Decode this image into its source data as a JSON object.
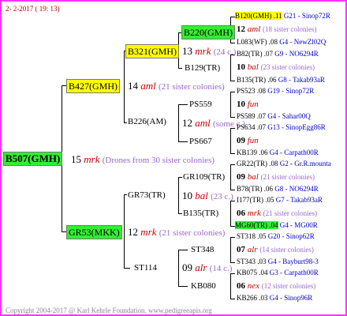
{
  "header_date": "2-  2-2017 ( 19: 13)",
  "footer": "Copyright 2004-2017 @ Karl Kehrle Foundation.   www.pedigreeapis.org",
  "colors": {
    "frame": "#ff33ff",
    "highlight_yellow": "#ffff00",
    "highlight_green": "#33ee33",
    "link_blue": "#0000cc",
    "note_purple": "#9966cc",
    "mating_red": "#cc0000"
  },
  "g0": {
    "name": "B507(GMH)",
    "num": "15",
    "mark": "mrk",
    "note": "(Drones from 30 sister colonies)"
  },
  "g1a": {
    "name": "B427(GMH)",
    "num": "14",
    "mark": "aml",
    "note": "(21 sister colonies)"
  },
  "g1b": {
    "name": "GR53(MKK)",
    "num": "12",
    "mark": "mrk",
    "note": "(21 sister colonies)"
  },
  "g2a": {
    "name": "B321(GMH)",
    "num": "13",
    "mark": "mrk",
    "note": "(24 c.)"
  },
  "g2b": {
    "name": "B226(AM)",
    "num": "12",
    "mark": "aml",
    "note": "(some c.)"
  },
  "g2c": {
    "name": "GR73(TR)",
    "num": "10",
    "mark": "bal",
    "note": "(23 c.)"
  },
  "g2d": {
    "name": "ST114",
    "num": "09",
    "mark": "alr",
    "note": "(14 c.)"
  },
  "g3": [
    {
      "name": "B220(GMH)"
    },
    {
      "name": "B129(TR)"
    },
    {
      "name": "PS559"
    },
    {
      "name": "PS667"
    },
    {
      "name": "GR109(TR)"
    },
    {
      "name": "B135(TR)"
    },
    {
      "name": "ST348"
    },
    {
      "name": "KB080"
    }
  ],
  "g4": [
    {
      "a": "B120(GMH) .11",
      "a_link": "G21 - Sinop72R",
      "num": "12",
      "mark": "aml",
      "note": "(18 sister colonies)",
      "b": "L083(WF) .08",
      "b_link": "G4 - NewZl02Q"
    },
    {
      "a": "B82(TR) .07",
      "a_link": "G9 - NO6294R",
      "num": "10",
      "mark": "bal",
      "note": "(23 sister colonies)",
      "b": "B135(TR) .06",
      "b_link": "G8 - Takab93aR"
    },
    {
      "a": "PS523 .08",
      "a_link": "G19 - Sinop72R",
      "num": "10",
      "mark": "fun",
      "note": "",
      "b": "PS589 .07",
      "b_link": "G4 - Sahar00Q"
    },
    {
      "a": "PS634 .07",
      "a_link": "G13 - SinopEgg86R",
      "num": "09",
      "mark": "fun",
      "note": "",
      "b": "KB139 .06",
      "b_link": "G4 - Carpath00R"
    },
    {
      "a": "GR22(TR) .08",
      "a_link": "G2 - Gr.R.mounta",
      "num": "09",
      "mark": "bal",
      "note": "(21 sister colonies)",
      "b": "B78(TR) .06",
      "b_link": "G8 - NO6294R"
    },
    {
      "a": "I177(TR) .05",
      "a_link": "G7 - Takab93aR",
      "num": "06",
      "mark": "mrk",
      "note": "(21 sister colonies)",
      "b": "MG60(TR) .04",
      "b_link": "G4 - MG00R"
    },
    {
      "a": "ST318 .05",
      "a_link": "G20 - Sinop62R",
      "num": "07",
      "mark": "alr",
      "note": "(14 sister colonies)",
      "b": "ST343 .03",
      "b_link": "G4 - Bayburt98-3"
    },
    {
      "a": "KB075 .04",
      "a_link": "G3 - Carpath00R",
      "num": "06",
      "mark": "nex",
      "note": "(12 sister colonies)",
      "b": "KB266 .03",
      "b_link": "G4 - Sinop96R"
    }
  ]
}
